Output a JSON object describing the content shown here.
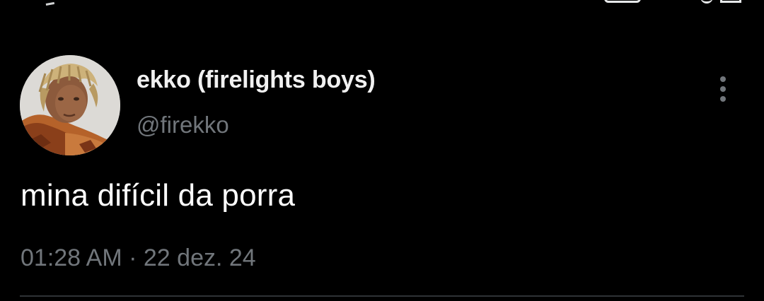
{
  "tweet": {
    "author": {
      "display_name": "ekko (firelights boys)",
      "handle": "@firekko"
    },
    "text": "mina difícil da porra",
    "time": "01:28 AM",
    "separator": "·",
    "date": "22 dez. 24",
    "more_icon": "more-vertical-icon"
  },
  "colors": {
    "background": "#000000",
    "primary_text": "#ffffff",
    "secondary_text": "#71767b",
    "divider": "#2f3336"
  }
}
